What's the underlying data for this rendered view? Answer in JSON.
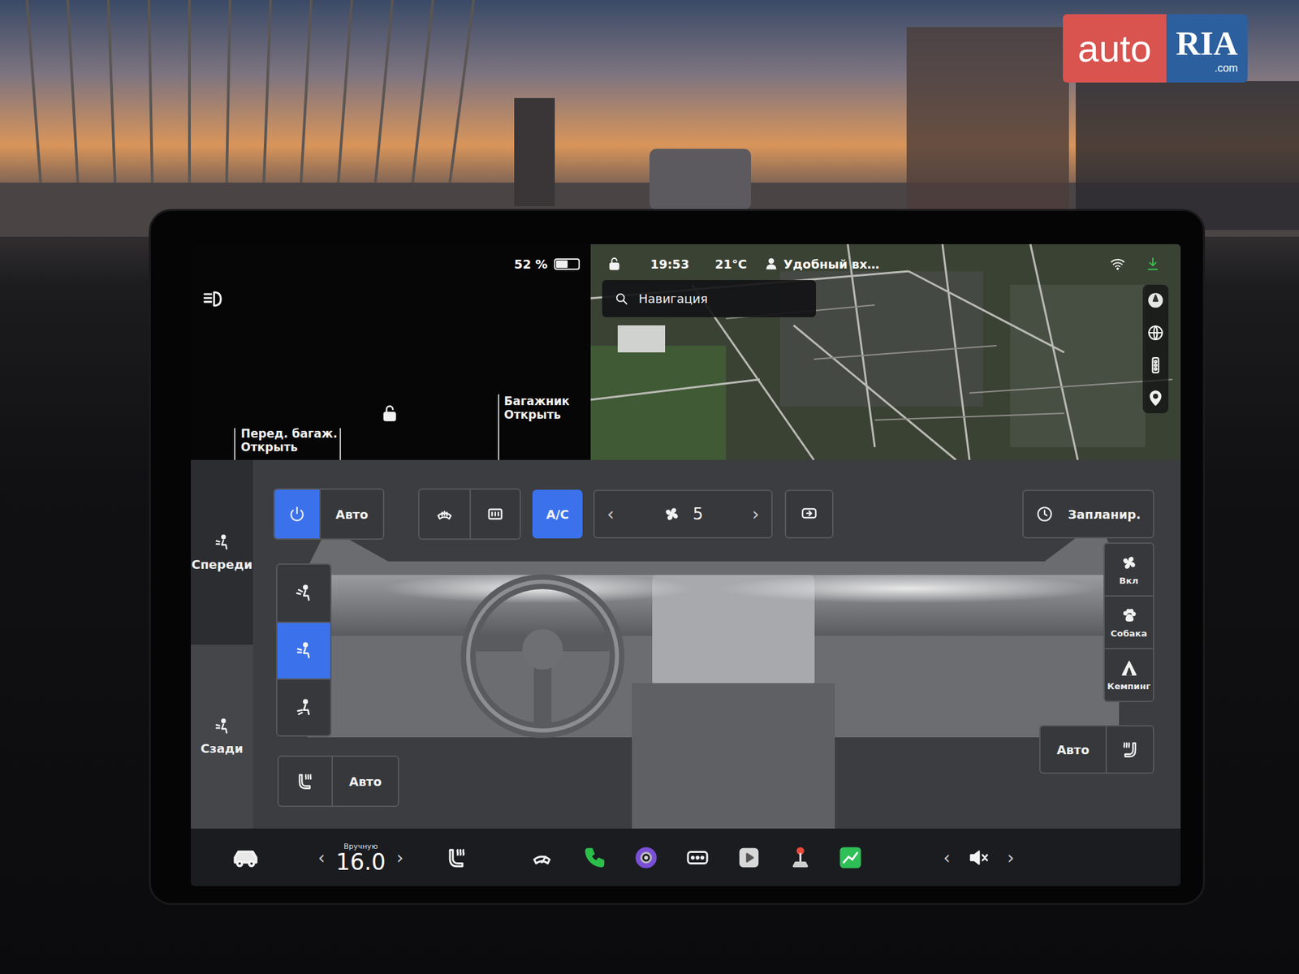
{
  "watermark": {
    "brand": "auto",
    "mark": "RIA",
    "domain": ".com"
  },
  "status_bar": {
    "battery": "52 %",
    "battery_level": 0.52,
    "locked": false,
    "time": "19:53",
    "temperature": "21°C",
    "profile": "Удобный вх…"
  },
  "car_panel": {
    "frunk": {
      "label": "Перед. багаж.",
      "action": "Открыть"
    },
    "trunk": {
      "label": "Багажник",
      "action": "Открыть"
    }
  },
  "map": {
    "search_placeholder": "Навигация"
  },
  "climate": {
    "power": {
      "on": true
    },
    "auto": "Авто",
    "defrost_front": {
      "on": false
    },
    "defrost_rear": {
      "on": false
    },
    "ac": {
      "label": "A/C",
      "on": true
    },
    "fan": {
      "prev": "‹",
      "speed": "5",
      "next": "›"
    },
    "recirculate": {
      "on": false
    },
    "schedule": "Запланир.",
    "zones": [
      {
        "label": "Спереди",
        "selected": true
      },
      {
        "label": "Сзади",
        "selected": false
      }
    ],
    "airflow_modes": [
      {
        "selected": false
      },
      {
        "selected": true
      },
      {
        "selected": false
      }
    ],
    "seat_heat_left": {
      "auto": "Авто"
    },
    "seat_heat_right": {
      "auto": "Авто"
    },
    "modes": [
      {
        "label": "Вкл"
      },
      {
        "label": "Собака"
      },
      {
        "label": "Кемпинг"
      }
    ]
  },
  "bottom_bar": {
    "temp_mode": "Вручную",
    "temperature": "16.0",
    "prev": "‹",
    "next": "›",
    "volume_prev": "‹",
    "volume_next": "›",
    "muted": true
  }
}
